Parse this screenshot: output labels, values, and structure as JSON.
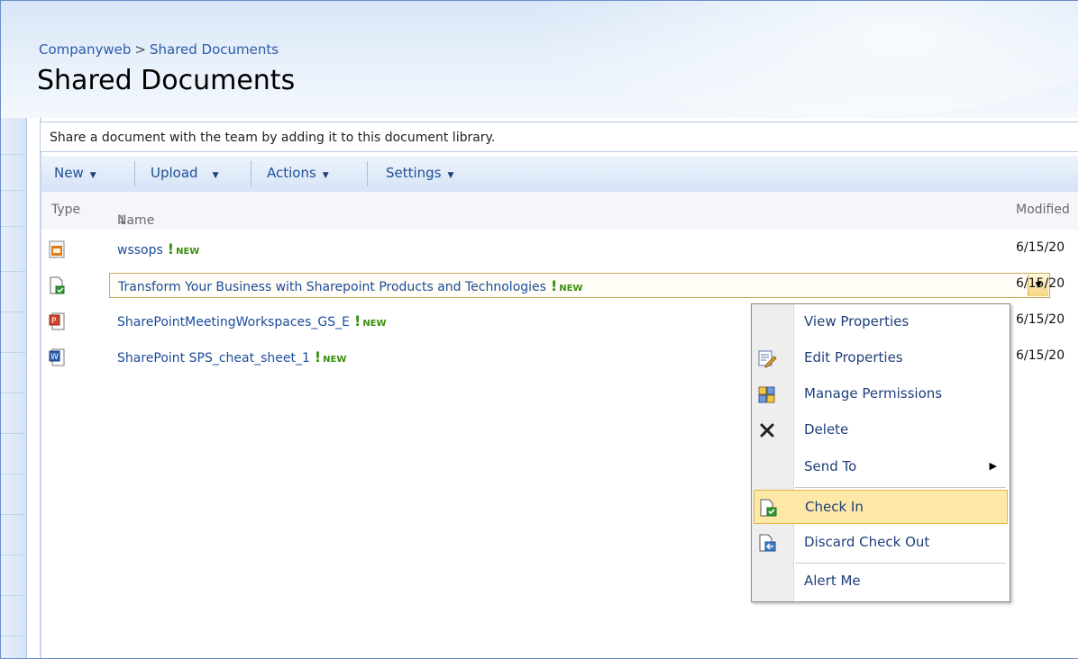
{
  "breadcrumb": {
    "site": "Companyweb",
    "separator": ">",
    "current": "Shared Documents"
  },
  "page_title": "Shared Documents",
  "description": "Share a document with the team by adding it to this document library.",
  "toolbar": {
    "new_label": "New",
    "upload_label": "Upload",
    "actions_label": "Actions",
    "settings_label": "Settings"
  },
  "columns": {
    "type": "Type",
    "name": "Name",
    "name_sort": "↓",
    "modified": "Modified"
  },
  "new_badge": {
    "mark": "!",
    "text": "NEW"
  },
  "rows": [
    {
      "name": "wssops",
      "modified": "6/15/20",
      "icon": "generic-doc-icon"
    },
    {
      "name": "Transform Your Business with Sharepoint Products and Technologies",
      "modified": "6/15/20",
      "icon": "checked-out-doc-icon"
    },
    {
      "name": "SharePointMeetingWorkspaces_GS_E",
      "modified": "6/15/20",
      "icon": "powerpoint-doc-icon"
    },
    {
      "name": "SharePoint SPS_cheat_sheet_1",
      "modified": "6/15/20",
      "icon": "word-doc-icon"
    }
  ],
  "context_menu": {
    "items": [
      {
        "label": "View Properties",
        "icon": ""
      },
      {
        "label": "Edit Properties",
        "icon": "edit-properties-icon"
      },
      {
        "label": "Manage Permissions",
        "icon": "permissions-icon"
      },
      {
        "label": "Delete",
        "icon": "delete-icon"
      },
      {
        "label": "Send To",
        "icon": "",
        "submenu": true
      },
      {
        "label": "Check In",
        "icon": "check-in-icon",
        "highlighted": true
      },
      {
        "label": "Discard Check Out",
        "icon": "discard-checkout-icon"
      },
      {
        "label": "Alert Me",
        "icon": ""
      }
    ]
  },
  "colors": {
    "link": "#1a4c9c",
    "new_green": "#3a8f10",
    "highlight": "#fde8a7"
  }
}
